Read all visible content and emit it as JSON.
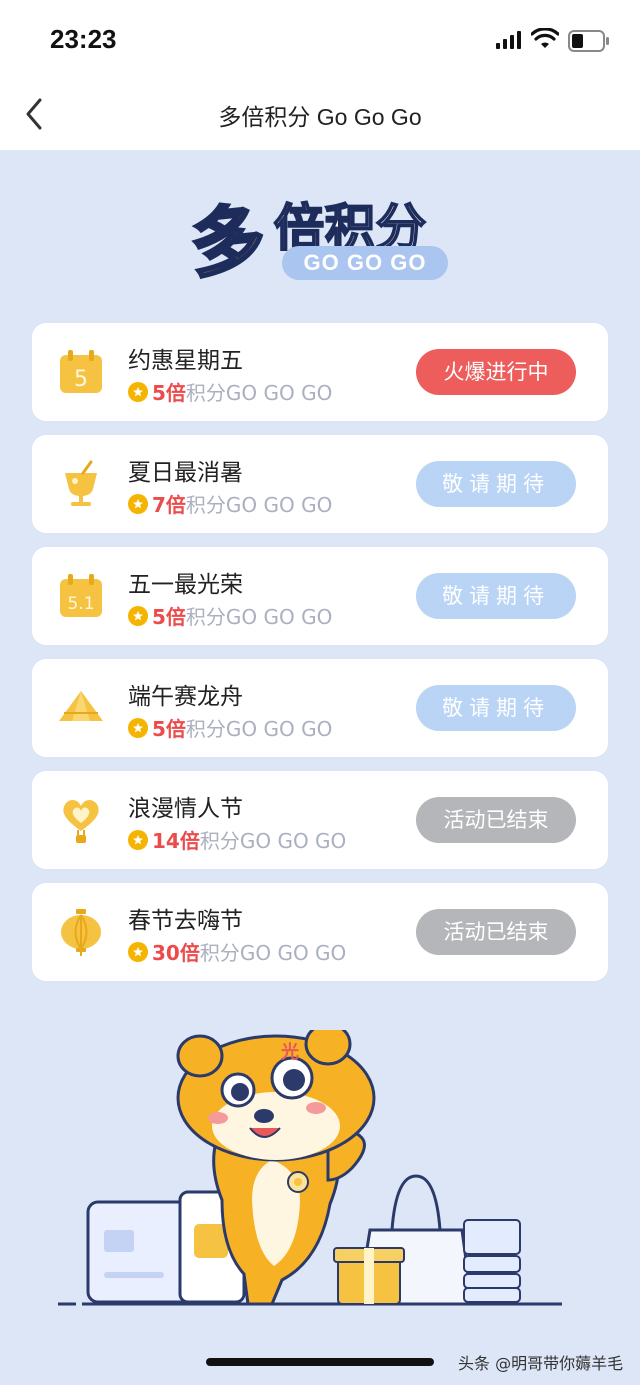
{
  "status_bar": {
    "time": "23:23"
  },
  "nav": {
    "title": "多倍积分 Go Go Go"
  },
  "hero": {
    "title_first": "多",
    "title_rest": "倍积分",
    "subtitle": "GO GO GO"
  },
  "cards": [
    {
      "title": "约惠星期五",
      "multiplier": "5倍",
      "suffix": "积分GO GO GO",
      "status": "火爆进行中",
      "icon": "calendar-5-icon",
      "state": "active"
    },
    {
      "title": "夏日最消暑",
      "multiplier": "7倍",
      "suffix": "积分GO GO GO",
      "status": "敬请期待",
      "icon": "cold-drink-icon",
      "state": "soon"
    },
    {
      "title": "五一最光荣",
      "multiplier": "5倍",
      "suffix": "积分GO GO GO",
      "status": "敬请期待",
      "icon": "calendar-51-icon",
      "state": "soon"
    },
    {
      "title": "端午赛龙舟",
      "multiplier": "5倍",
      "suffix": "积分GO GO GO",
      "status": "敬请期待",
      "icon": "zongzi-icon",
      "state": "soon"
    },
    {
      "title": "浪漫情人节",
      "multiplier": "14倍",
      "suffix": "积分GO GO GO",
      "status": "活动已结束",
      "icon": "heart-balloon-icon",
      "state": "ended"
    },
    {
      "title": "春节去嗨节",
      "multiplier": "30倍",
      "suffix": "积分GO GO GO",
      "status": "活动已结束",
      "icon": "lantern-icon",
      "state": "ended"
    }
  ],
  "mascot": {
    "badge": "光"
  },
  "watermark": "头条 @明哥带你薅羊毛",
  "colors": {
    "background": "#dce6f7",
    "accent_red": "#ec5d5c",
    "soon_blue": "#b9d4f4",
    "ended_gray": "#b5b6b9",
    "gold": "#f4b400"
  }
}
